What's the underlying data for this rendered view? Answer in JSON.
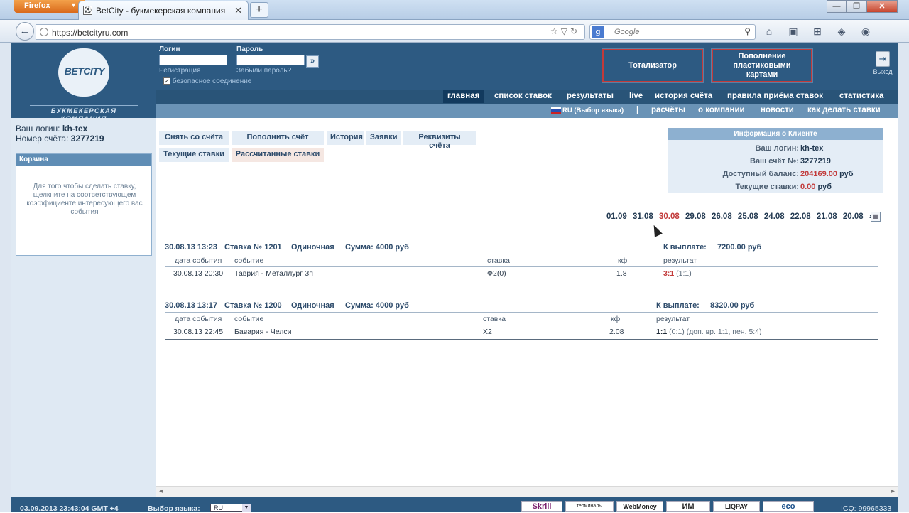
{
  "browser": {
    "app_menu": "Firefox",
    "tab_title": "BetCity - букмекерская компания",
    "url": "https://betcityru.com",
    "search_placeholder": "Google"
  },
  "header": {
    "logo_text": "BETCITY",
    "logo_sub": "БУКМЕКЕРСКАЯ КОМПАНИЯ",
    "login_label": "Логин",
    "password_label": "Пароль",
    "register_link": "Регистрация",
    "forgot_link": "Забыли пароль?",
    "go_button": "»",
    "secure_label": "безопасное соединение",
    "totalizator": "Тотализатор",
    "cards_topup": "Пополнение пластиковыми картами",
    "exit_label": "Выход"
  },
  "menu_primary": [
    "главная",
    "список ставок",
    "результаты",
    "live",
    "история счёта",
    "правила приёма ставок",
    "статистика"
  ],
  "menu_secondary": {
    "lang": "RU (Выбор языка)",
    "sep": "|",
    "items": [
      "расчёты",
      "о компании",
      "новости",
      "как делать ставки"
    ]
  },
  "account": {
    "login_label": "Ваш логин:",
    "login_value": "kh-tex",
    "number_label": "Номер счёта:",
    "number_value": "3277219"
  },
  "basket": {
    "title": "Корзина",
    "message": "Для того чтобы сделать ставку, щелкните на соответствующем коэффициенте интересующего вас события"
  },
  "action_tabs": {
    "withdraw": "Снять со счёта",
    "deposit": "Пополнить счёт",
    "history": "История",
    "requests": "Заявки",
    "details": "Реквизиты счёта",
    "current_bets": "Текущие ставки",
    "settled_bets": "Рассчитанные ставки"
  },
  "client_info": {
    "title": "Информация о Клиенте",
    "login_label": "Ваш логин:",
    "login_value": "kh-tex",
    "account_label": "Ваш счёт №:",
    "account_value": "3277219",
    "balance_label": "Доступный баланс:",
    "balance_value": "204169.00",
    "balance_unit": "руб",
    "current_label": "Текущие ставки:",
    "current_value": "0.00",
    "current_unit": "руб"
  },
  "dates": {
    "list": [
      "01.09",
      "31.08",
      "30.08",
      "29.08",
      "26.08",
      "25.08",
      "24.08",
      "22.08",
      "21.08",
      "20.08"
    ],
    "current": "30.08",
    "more": "»"
  },
  "bets": [
    {
      "datetime": "30.08.13 13:23",
      "bet_no": "Ставка № 1201",
      "kind": "Одиночная",
      "sum": "Сумма: 4000 руб",
      "payout_label": "К выплате:",
      "payout_value": "7200.00 руб",
      "cols": [
        "дата события",
        "событие",
        "ставка",
        "кф",
        "результат"
      ],
      "event_date": "30.08.13 20:30",
      "event": "Таврия - Металлург Зп",
      "stake": "Ф2(0)",
      "coef": "1.8",
      "result_bold": "3:1",
      "result_rest": "(1:1)"
    },
    {
      "datetime": "30.08.13 13:17",
      "bet_no": "Ставка № 1200",
      "kind": "Одиночная",
      "sum": "Сумма: 4000 руб",
      "payout_label": "К выплате:",
      "payout_value": "8320.00 руб",
      "cols": [
        "дата события",
        "событие",
        "ставка",
        "кф",
        "результат"
      ],
      "event_date": "30.08.13 22:45",
      "event": "Бавария - Челси",
      "stake": "X2",
      "coef": "2.08",
      "result_bold": "1:1",
      "result_rest": "(0:1) (доп. вр. 1:1, пен. 5:4)"
    }
  ],
  "footer": {
    "datetime": "03.09.2013  23:43:04  GMT +4",
    "lang_label": "Выбор языка:",
    "lang_value": "RU",
    "payments": [
      "Skrill",
      "терминалы",
      "WebMoney",
      "ИМ",
      "LIQPAY",
      "eco"
    ],
    "icq": "ICQ: 99965333"
  },
  "colors": {
    "header": "#2d5a82",
    "accent_red": "#c23a3a",
    "sidebar": "#dfe9f3"
  }
}
